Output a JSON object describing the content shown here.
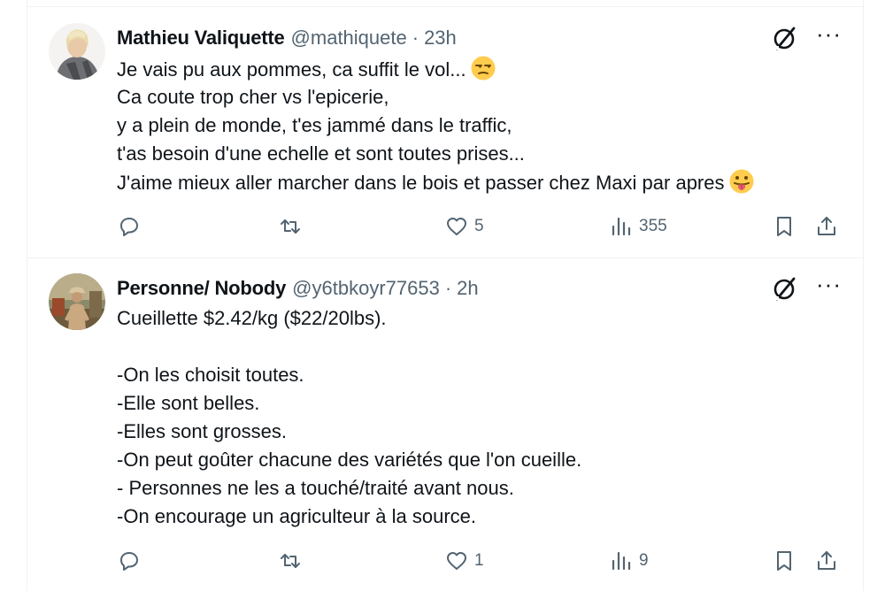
{
  "tweets": [
    {
      "author_name": "Mathieu Valiquette",
      "handle": "@mathiquete",
      "separator": "·",
      "time": "23h",
      "text_lines": [
        "Je vais pu aux pommes, ca suffit le vol...",
        "Ca coute trop cher vs l'epicerie,",
        "y a plein de monde, t'es jammé dans le traffic,",
        "t'as besoin d'une echelle et sont toutes prises...",
        "J'aime mieux aller marcher dans le bois et passer chez Maxi par apres"
      ],
      "emojis": [
        "unamused-face-emoji",
        "tongue-out-face-emoji"
      ],
      "reply_count": "",
      "retweet_count": "",
      "like_count": "5",
      "view_count": "355",
      "more_label": "···"
    },
    {
      "author_name": "Personne/ Nobody",
      "handle": "@y6tbkoyr77653",
      "separator": "·",
      "time": "2h",
      "text_lines": [
        "Cueillette $2.42/kg ($22/20lbs).",
        "",
        "-On les choisit toutes.",
        "-Elle sont belles.",
        "-Elles sont grosses.",
        "-On peut goûter chacune des variétés que l'on cueille.",
        "- Personnes ne les a touché/traité avant nous.",
        "-On encourage un agriculteur à la source."
      ],
      "reply_count": "",
      "retweet_count": "",
      "like_count": "1",
      "view_count": "9",
      "more_label": "···"
    }
  ],
  "colors": {
    "text": "#0f1419",
    "secondary": "#536471",
    "border": "#eff3f4"
  }
}
